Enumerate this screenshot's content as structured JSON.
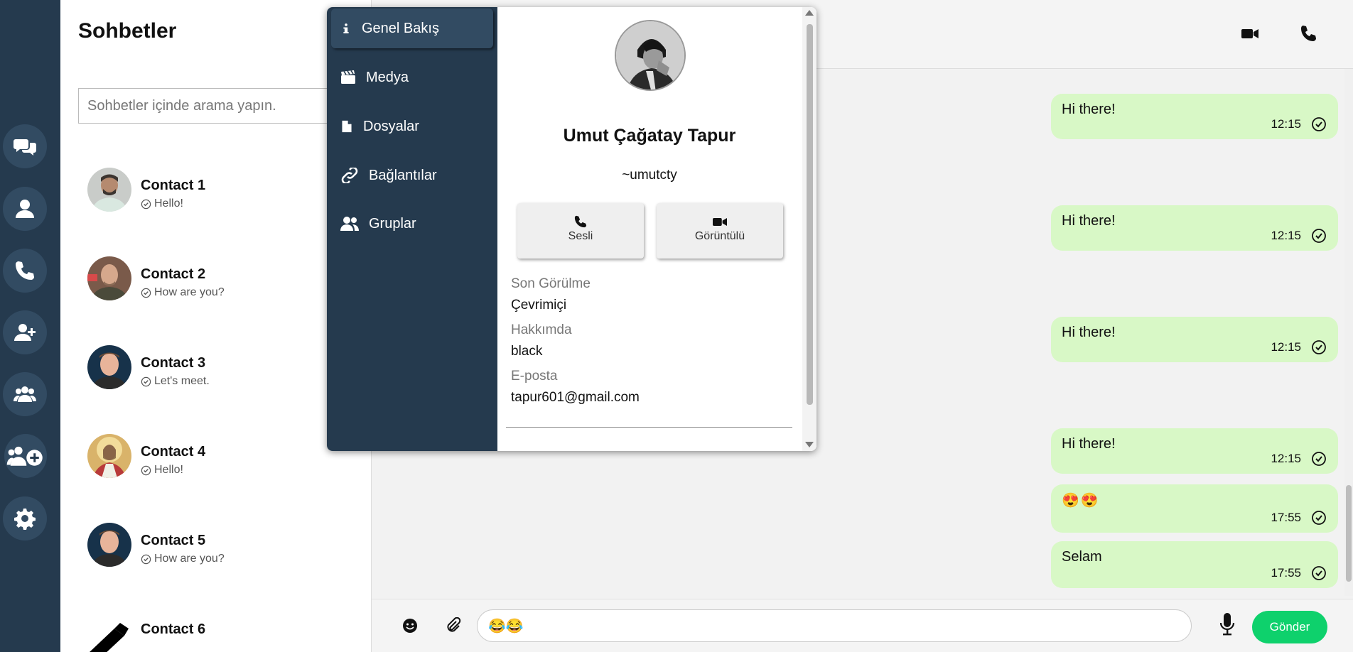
{
  "sidebar": {
    "icons": [
      "chats-icon",
      "profile-icon",
      "phone-icon",
      "add-user-icon",
      "groups-icon",
      "add-group-icon",
      "settings-icon"
    ]
  },
  "chat_list": {
    "title": "Sohbetler",
    "search_placeholder": "Sohbetler içinde arama yapın.",
    "contacts": [
      {
        "name": "Contact 1",
        "last": "Hello!"
      },
      {
        "name": "Contact 2",
        "last": "How are you?"
      },
      {
        "name": "Contact 3",
        "last": "Let's meet."
      },
      {
        "name": "Contact 4",
        "last": "Hello!"
      },
      {
        "name": "Contact 5",
        "last": "How are you?"
      },
      {
        "name": "Contact 6",
        "last": ""
      }
    ]
  },
  "conversation": {
    "messages": [
      {
        "text": "Hi there!",
        "time": "12:15"
      },
      {
        "text": "Hi there!",
        "time": "12:15"
      },
      {
        "text": "Hi there!",
        "time": "12:15"
      },
      {
        "text": "Hi there!",
        "time": "12:15"
      },
      {
        "text": "😍😍",
        "time": "17:55"
      },
      {
        "text": "Selam",
        "time": "17:55"
      }
    ],
    "draft": "😂😂",
    "send_label": "Gönder"
  },
  "overlay": {
    "nav": [
      {
        "label": "Genel Bakış",
        "icon": "info-icon",
        "active": true
      },
      {
        "label": "Medya",
        "icon": "media-icon",
        "active": false
      },
      {
        "label": "Dosyalar",
        "icon": "file-icon",
        "active": false
      },
      {
        "label": "Bağlantılar",
        "icon": "link-icon",
        "active": false
      },
      {
        "label": "Gruplar",
        "icon": "groups-icon",
        "active": false
      }
    ],
    "profile": {
      "name": "Umut Çağatay Tapur",
      "username": "~umutcty",
      "voice_label": "Sesli",
      "video_label": "Görüntülü",
      "last_seen_label": "Son Görülme",
      "last_seen_value": "Çevrimiçi",
      "about_label": "Hakkımda",
      "about_value": "black",
      "email_label": "E-posta",
      "email_value": "tapur601@gmail.com"
    }
  },
  "colors": {
    "rail": "#253a4e",
    "bubble": "#d8f8c6",
    "send": "#0ed16c"
  }
}
